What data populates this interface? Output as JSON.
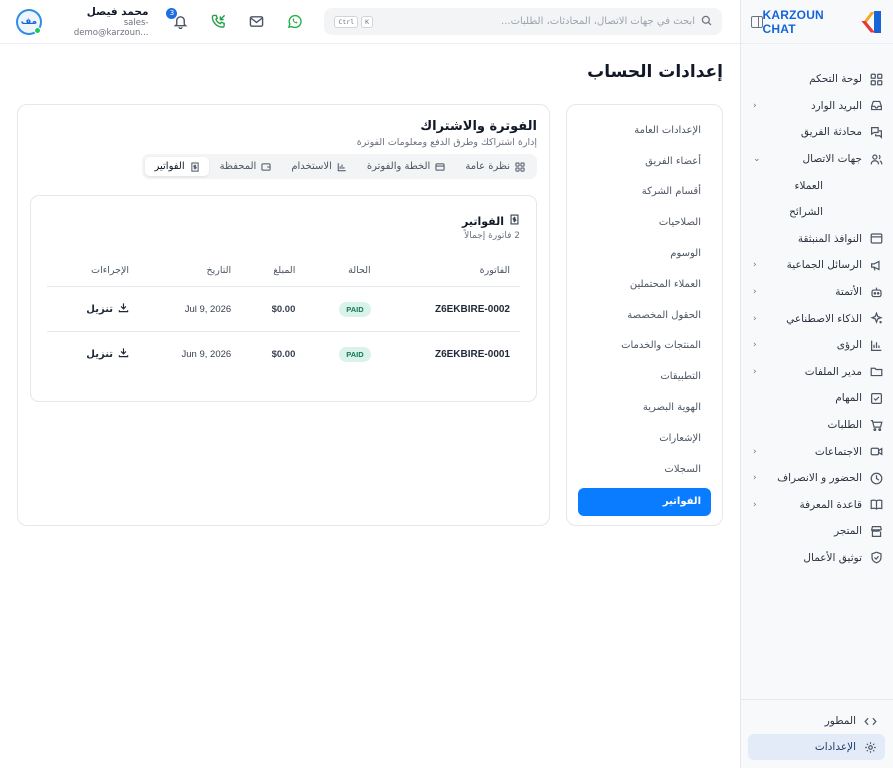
{
  "brand": {
    "name": "KARZOUN CHAT"
  },
  "sidebar": {
    "items": [
      {
        "label": "لوحة التحكم",
        "icon": "dashboard-icon"
      },
      {
        "label": "البريد الوارد",
        "icon": "inbox-icon",
        "chevron": "‹"
      },
      {
        "label": "محادثة الفريق",
        "icon": "team-chat-icon"
      },
      {
        "label": "جهات الاتصال",
        "icon": "contacts-icon",
        "chevron": "⌄"
      }
    ],
    "sub_items": [
      "العملاء",
      "الشرائح"
    ],
    "items2": [
      {
        "label": "النوافذ المنبثقة",
        "icon": "popup-icon"
      },
      {
        "label": "الرسائل الجماعية",
        "icon": "megaphone-icon",
        "chevron": "‹"
      },
      {
        "label": "الأتمتة",
        "icon": "bot-icon",
        "chevron": "‹"
      },
      {
        "label": "الذكاء الاصطناعي",
        "icon": "sparkle-icon",
        "chevron": "‹"
      },
      {
        "label": "الرؤى",
        "icon": "chart-icon",
        "chevron": "‹"
      },
      {
        "label": "مدير الملفات",
        "icon": "folder-icon",
        "chevron": "‹"
      },
      {
        "label": "المهام",
        "icon": "task-icon"
      },
      {
        "label": "الطلبات",
        "icon": "cart-icon"
      },
      {
        "label": "الاجتماعات",
        "icon": "video-icon",
        "chevron": "‹"
      },
      {
        "label": "الحضور و الانصراف",
        "icon": "clock-icon",
        "chevron": "‹"
      },
      {
        "label": "قاعدة المعرفة",
        "icon": "book-icon",
        "chevron": "‹"
      },
      {
        "label": "المتجر",
        "icon": "store-icon"
      },
      {
        "label": "توثيق الأعمال",
        "icon": "shield-check-icon"
      }
    ],
    "bottom": [
      {
        "label": "المطور",
        "icon": "code-icon"
      },
      {
        "label": "الإعدادات",
        "icon": "gear-icon"
      }
    ]
  },
  "topbar": {
    "search_placeholder": "ابحث في جهات الاتصال، المحادثات، الطلبات...",
    "kbd": [
      "K",
      "Ctrl"
    ],
    "notifications_count": "3",
    "user_initials": "مف",
    "user_name": "محمد فيصل",
    "user_email": "sales-demo@karzoun..."
  },
  "page": {
    "title": "إعدادات الحساب"
  },
  "settings_menu": [
    "الإعدادات العامة",
    "أعضاء الفريق",
    "أقسام الشركة",
    "الصلاحيات",
    "الوسوم",
    "العملاء المحتملين",
    "الحقول المخصصة",
    "المنتجات والخدمات",
    "التطبيقات",
    "الهوية البصرية",
    "الإشعارات",
    "السجلات",
    "الفواتير"
  ],
  "billing": {
    "title": "الفوترة والاشتراك",
    "subtitle": "إدارة اشتراكك وطرق الدفع ومعلومات الفوترة",
    "tabs": [
      "نظرة عامة",
      "الخطة والفوترة",
      "الاستخدام",
      "المحفظة",
      "الفواتير"
    ],
    "invoices": {
      "title": "الفواتير",
      "count_text": "2 فاتورة إجمالاً",
      "headers": [
        "الفاتورة",
        "الحالة",
        "المبلغ",
        "التاريخ",
        "الإجراءات"
      ],
      "rows": [
        {
          "id": "Z6EKBIRE-0002",
          "status": "PAID",
          "amount": "$0.00",
          "date": "Jul 9, 2026",
          "action": "تنزيل"
        },
        {
          "id": "Z6EKBIRE-0001",
          "status": "PAID",
          "amount": "$0.00",
          "date": "Jun 9, 2026",
          "action": "تنزيل"
        }
      ]
    }
  },
  "colors": {
    "primary": "#0a7cff",
    "brand": "#1565d8",
    "paid_bg": "#d9f3ea",
    "paid_text": "#157857",
    "whatsapp": "#25b14a"
  }
}
